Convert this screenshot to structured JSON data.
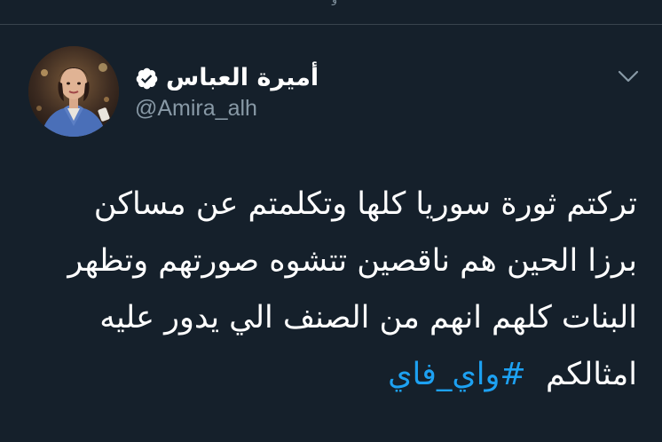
{
  "tweet": {
    "author": {
      "display_name": "أميرة العباس",
      "handle": "@Amira_alh",
      "verified": true
    },
    "text_lines": [
      "تركتم ثورة سوريا كلها وتكلمتم عن مساكن",
      "برزا الحين هم ناقصين تتشوه صورتهم وتظهر",
      "البنات كلهم انهم من الصنف الي يدور عليه"
    ],
    "last_line_text": "امثالكم",
    "hashtag": "#واي_فاي"
  },
  "icons": {
    "verified": "verified-badge-icon",
    "menu": "chevron-down-icon"
  },
  "colors": {
    "background": "#15202b",
    "divider": "#38444d",
    "text": "#ffffff",
    "secondary_text": "#8899a6",
    "link": "#1da1f2"
  }
}
